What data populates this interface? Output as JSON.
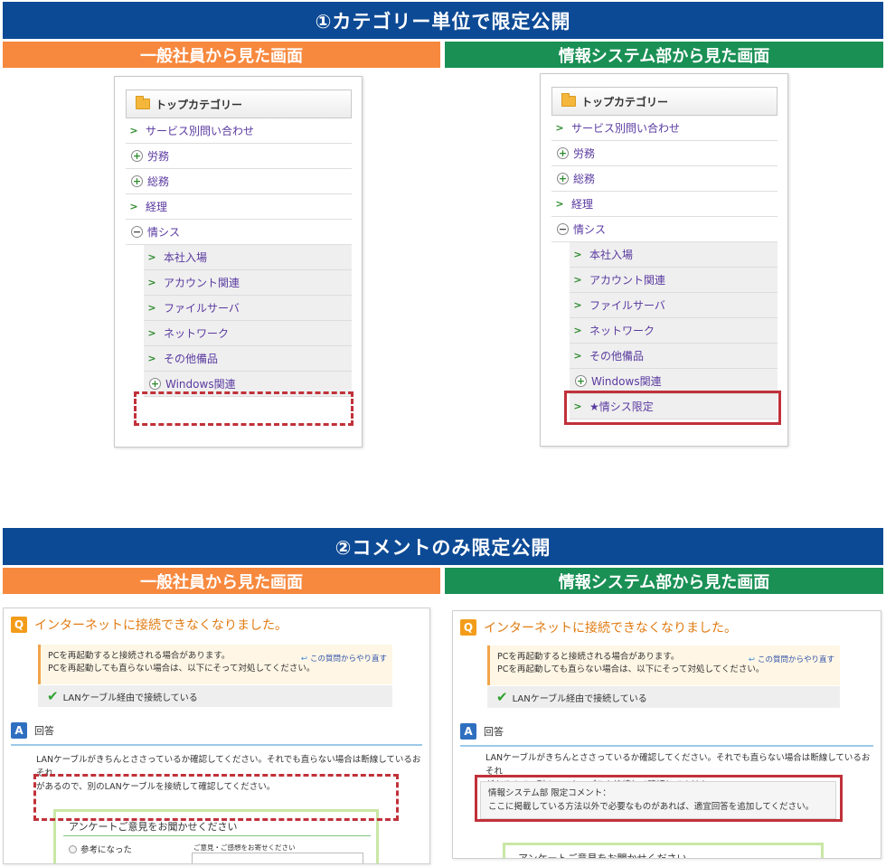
{
  "section1": {
    "title": "①カテゴリー単位で限定公開",
    "general_label": "一般社員から見た画面",
    "info_label": "情報システム部から見た画面"
  },
  "section2": {
    "title": "②コメントのみ限定公開",
    "general_label": "一般社員から見た画面",
    "info_label": "情報システム部から見た画面"
  },
  "category": {
    "header": "トップカテゴリー",
    "top_items": [
      {
        "label": "サービス別問い合わせ",
        "marker": "chevron"
      },
      {
        "label": "労務",
        "marker": "plus"
      },
      {
        "label": "総務",
        "marker": "plus"
      },
      {
        "label": "経理",
        "marker": "chevron"
      },
      {
        "label": "情シス",
        "marker": "minus"
      }
    ],
    "sub_items": [
      {
        "label": "本社入場",
        "marker": "chevron"
      },
      {
        "label": "アカウント関連",
        "marker": "chevron"
      },
      {
        "label": "ファイルサーバ",
        "marker": "chevron"
      },
      {
        "label": "ネットワーク",
        "marker": "chevron"
      },
      {
        "label": "その他備品",
        "marker": "chevron"
      },
      {
        "label": "Windows関連",
        "marker": "plus"
      }
    ],
    "limited_item": "★情シス限定"
  },
  "qa": {
    "question": "インターネットに接続できなくなりました。",
    "notice_line1": "PCを再起動すると接続される場合があります。",
    "notice_line2": "PCを再起動しても直らない場合は、以下にそって対処してください。",
    "back_link": "この質問からやり直す",
    "solved_label": "LANケーブル経由で接続している",
    "answer_heading": "回答",
    "answer_line1": "LANケーブルがきちんとささっているか確認してください。それでも直らない場合は断線しているおそれ",
    "answer_line2": "があるので、別のLANケーブルを接続して確認してください。",
    "survey_title": "アンケートご意見をお聞かせください",
    "survey_option": "参考になった",
    "feedback_label": "ご意見・ご感想をお寄せください",
    "limited_comment_title": "情報システム部 限定コメント：",
    "limited_comment_body": "ここに掲載している方法以外で必要なものがあれば、適宜回答を追加してください。"
  },
  "colors": {
    "section_blue": "#0d4a95",
    "general_orange": "#f7893f",
    "info_green": "#1a9055",
    "highlight_red": "#c1313a"
  }
}
